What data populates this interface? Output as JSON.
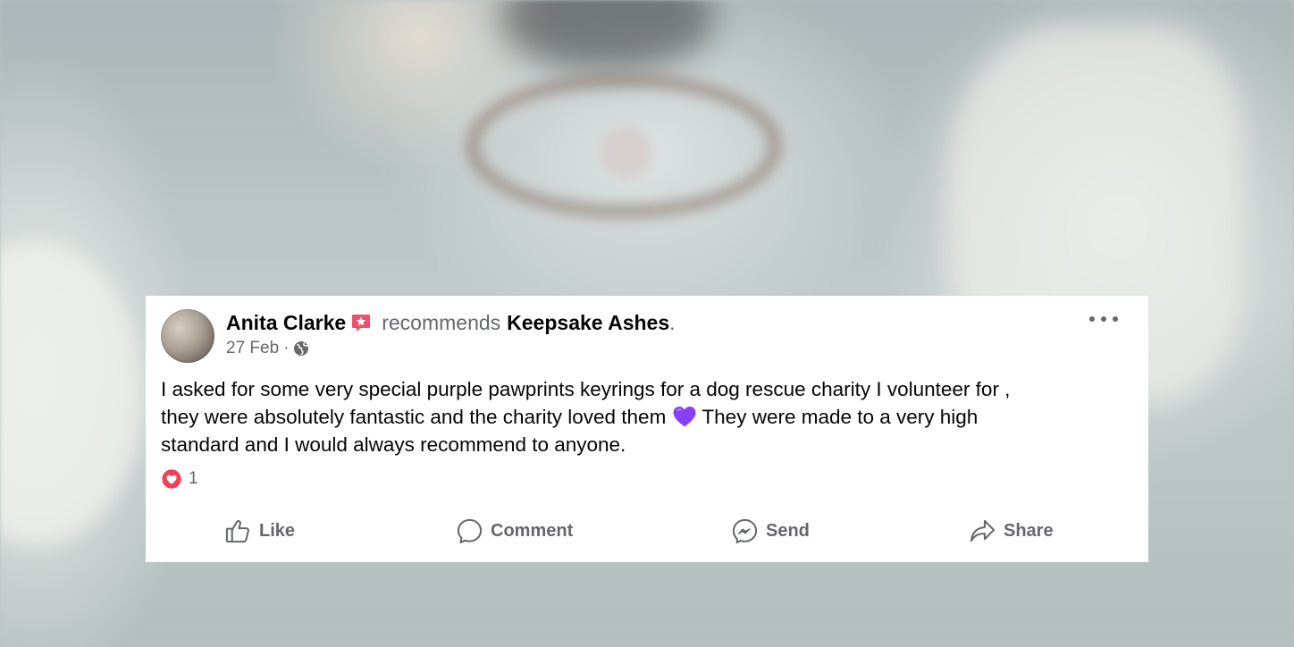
{
  "post": {
    "author": "Anita Clarke",
    "action_text": "recommends",
    "page_name": "Keepsake Ashes",
    "trailing_punct": ".",
    "date": "27 Feb",
    "separator": "·",
    "privacy_icon": "globe-icon",
    "text_line1": "I asked for some very special purple pawprints keyrings for a dog rescue charity I volunteer for ,",
    "text_line2_before_emoji": "they were absolutely fantastic and the charity loved them ",
    "emoji": "purple-heart-icon",
    "text_line2_after_emoji": " They were made to a very high",
    "text_line3": "standard and I would always recommend to anyone.",
    "reaction_icon": "love-reaction-icon",
    "reaction_count": "1"
  },
  "actions": {
    "like": "Like",
    "comment": "Comment",
    "send": "Send",
    "share": "Share"
  },
  "colors": {
    "recommend_badge": "#f0506e",
    "love_reaction": "#f33e58",
    "emoji_purple": "#8a3ffc",
    "secondary_text": "#65676b",
    "primary_text": "#050505"
  }
}
